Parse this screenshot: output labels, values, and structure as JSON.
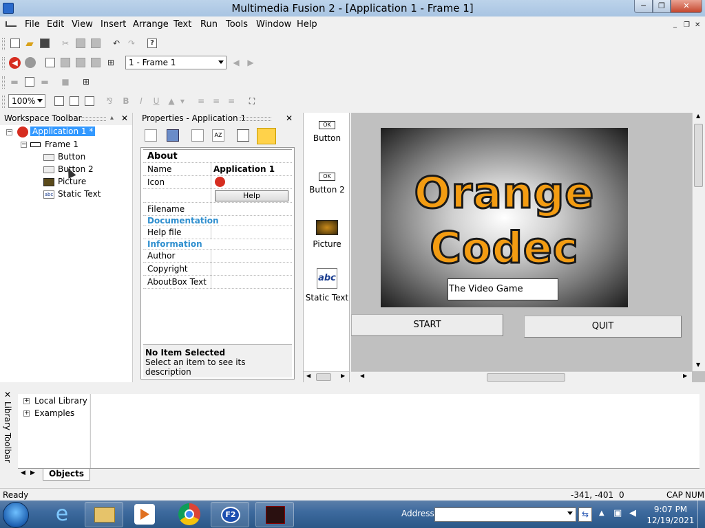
{
  "window": {
    "title": "Multimedia Fusion 2 - [Application 1 - Frame 1]",
    "min_glyph": "─",
    "max_glyph": "❐",
    "close_glyph": "✕"
  },
  "menu": {
    "items": [
      "File",
      "Edit",
      "View",
      "Insert",
      "Arrange",
      "Text",
      "Run",
      "Tools",
      "Window",
      "Help"
    ],
    "mdi_min": "_",
    "mdi_restore": "❐",
    "mdi_close": "✕"
  },
  "toolbar": {
    "frame_select": "1 - Frame 1",
    "zoom": "100%"
  },
  "workspace": {
    "title": "Workspace Toolbar",
    "tree": {
      "app": "Application 1 *",
      "frame": "Frame 1",
      "objects": [
        "Button",
        "Button 2",
        "Picture",
        "Static Text"
      ]
    }
  },
  "properties": {
    "title": "Properties - Application 1",
    "rows": {
      "about": "About",
      "name_key": "Name",
      "name_val": "Application 1",
      "icon_key": "Icon",
      "help_button": "Help",
      "filename_key": "Filename",
      "doc_section": "Documentation",
      "helpfile_key": "Help file",
      "info_section": "Information",
      "author_key": "Author",
      "copyright_key": "Copyright",
      "aboutbox_key": "AboutBox Text"
    },
    "desc_title": "No Item Selected",
    "desc_text": "Select an item to see its description"
  },
  "object_bar": {
    "items": [
      "Button",
      "Button 2",
      "Picture",
      "Static Text"
    ],
    "button_icon_text": "OK",
    "abc_text": "abc"
  },
  "frame": {
    "logo_line1": "Orange",
    "logo_line2": "Codec",
    "static_text": "The Video Game",
    "start_button": "START",
    "quit_button": "QUIT"
  },
  "library": {
    "title": "Library Toolbar",
    "tree": [
      "Local Library",
      "Examples"
    ],
    "tab": "Objects"
  },
  "status": {
    "left": "Ready",
    "coords": "-341, -401",
    "value": "0",
    "cap": "CAP",
    "num": "NUM"
  },
  "taskbar": {
    "address_label": "Address",
    "time": "9:07 PM",
    "date": "12/19/2021",
    "colors": {
      "bar": "#3d6a9e"
    }
  },
  "colors": {
    "accent_orange": "#f39c12",
    "section_blue": "#2f8fcf",
    "selection": "#3399ff"
  }
}
